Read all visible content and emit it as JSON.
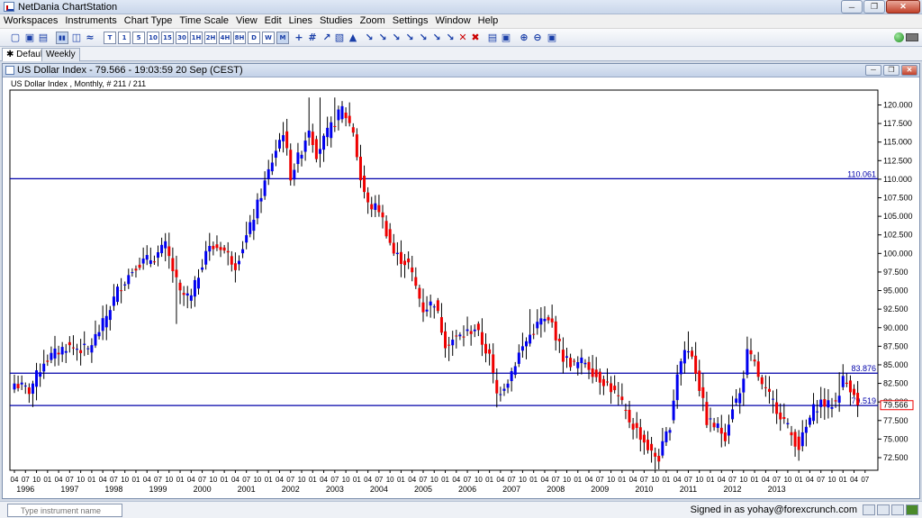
{
  "window": {
    "title": "NetDania ChartStation"
  },
  "menu": [
    "Workspaces",
    "Instruments",
    "Chart Type",
    "Time Scale",
    "View",
    "Edit",
    "Lines",
    "Studies",
    "Zoom",
    "Settings",
    "Window",
    "Help"
  ],
  "toolbar": {
    "interval_labels": [
      "T",
      "1",
      "5",
      "10",
      "15",
      "30",
      "1H",
      "2H",
      "4H",
      "8H",
      "D",
      "W",
      "M"
    ]
  },
  "tabs": [
    {
      "label": "Default"
    },
    {
      "label": "Weekly"
    }
  ],
  "chart_window": {
    "title": "US Dollar Index - 79.566 - 19:03:59  20 Sep (CEST)",
    "subtitle": "US Dollar Index , Monthly, # 211 / 211"
  },
  "search": {
    "placeholder": "Type instrument name"
  },
  "status": {
    "signed_in": "Signed in as yohay@forexcrunch.com"
  },
  "chart_data": {
    "type": "candlestick",
    "instrument": "US Dollar Index",
    "interval": "Monthly",
    "ylim": [
      70.8,
      122.0
    ],
    "y_ticks": [
      "72.500",
      "75.000",
      "77.500",
      "80.000",
      "82.500",
      "85.000",
      "87.500",
      "90.000",
      "92.500",
      "95.000",
      "97.500",
      "100.000",
      "102.500",
      "105.000",
      "107.500",
      "110.000",
      "112.500",
      "115.000",
      "117.500",
      "120.000"
    ],
    "year_labels": [
      "1996",
      "1997",
      "1998",
      "1999",
      "2000",
      "2001",
      "2002",
      "2003",
      "2004",
      "2005",
      "2006",
      "2007",
      "2008",
      "2009",
      "2010",
      "2011",
      "2012",
      "2013"
    ],
    "month_labels": [
      "04",
      "07",
      "10",
      "01"
    ],
    "horizontal_lines": [
      {
        "label": "110.061",
        "value": 110.061
      },
      {
        "label": "83.876",
        "value": 83.876
      },
      {
        "label": "79.519",
        "value": 79.519
      }
    ],
    "last_price": {
      "label": "79.566",
      "value": 79.566
    },
    "colors": {
      "up": "#0000ee",
      "down": "#ee0000",
      "line": "#0000aa"
    },
    "anchors": [
      [
        0,
        82.5
      ],
      [
        4,
        81.5
      ],
      [
        8,
        85.5
      ],
      [
        14,
        87.5
      ],
      [
        20,
        87.0
      ],
      [
        24,
        90.5
      ],
      [
        28,
        95.0
      ],
      [
        33,
        98.5
      ],
      [
        38,
        99.5
      ],
      [
        41,
        101.0
      ],
      [
        45,
        94.5
      ],
      [
        48,
        94.0
      ],
      [
        52,
        100.5
      ],
      [
        56,
        101.0
      ],
      [
        60,
        98.5
      ],
      [
        64,
        103.5
      ],
      [
        68,
        109.5
      ],
      [
        71,
        114.0
      ],
      [
        73,
        116.5
      ],
      [
        75,
        110.5
      ],
      [
        78,
        114.0
      ],
      [
        80,
        117.0
      ],
      [
        82,
        113.5
      ],
      [
        86,
        117.0
      ],
      [
        89,
        119.5
      ],
      [
        92,
        116.5
      ],
      [
        94,
        110.0
      ],
      [
        96,
        106.5
      ],
      [
        99,
        106.0
      ],
      [
        103,
        100.0
      ],
      [
        107,
        98.5
      ],
      [
        111,
        92.5
      ],
      [
        114,
        93.5
      ],
      [
        117,
        88.0
      ],
      [
        122,
        89.0
      ],
      [
        125,
        90.0
      ],
      [
        129,
        86.0
      ],
      [
        131,
        81.0
      ],
      [
        134,
        83.0
      ],
      [
        137,
        86.5
      ],
      [
        140,
        89.0
      ],
      [
        143,
        91.0
      ],
      [
        146,
        90.5
      ],
      [
        149,
        86.0
      ],
      [
        152,
        85.0
      ],
      [
        155,
        85.5
      ],
      [
        158,
        83.5
      ],
      [
        161,
        82.5
      ],
      [
        164,
        80.5
      ],
      [
        167,
        77.5
      ],
      [
        170,
        75.5
      ],
      [
        173,
        73.0
      ],
      [
        175,
        72.5
      ],
      [
        178,
        77.0
      ],
      [
        180,
        84.0
      ],
      [
        182,
        87.0
      ],
      [
        184,
        86.5
      ],
      [
        186,
        82.0
      ],
      [
        188,
        77.5
      ],
      [
        191,
        76.5
      ],
      [
        193,
        75.5
      ],
      [
        195,
        79.5
      ],
      [
        197,
        81.0
      ],
      [
        199,
        86.5
      ],
      [
        201,
        85.0
      ],
      [
        203,
        82.0
      ],
      [
        206,
        80.0
      ],
      [
        209,
        77.5
      ],
      [
        211,
        75.5
      ],
      [
        213,
        74.0
      ],
      [
        215,
        76.5
      ],
      [
        217,
        79.0
      ],
      [
        219,
        80.0
      ],
      [
        221,
        79.5
      ],
      [
        223,
        80.0
      ],
      [
        225,
        83.0
      ],
      [
        227,
        82.0
      ],
      [
        228,
        81.5
      ],
      [
        229,
        79.6
      ]
    ],
    "spikes": [
      [
        44,
        90.5,
        "low"
      ],
      [
        80,
        121.0,
        "high"
      ],
      [
        83,
        121.0,
        "high"
      ],
      [
        87,
        121.0,
        "high"
      ],
      [
        118,
        85.5,
        "low"
      ],
      [
        140,
        92.5,
        "high"
      ],
      [
        174,
        70.9,
        "low"
      ],
      [
        183,
        89.5,
        "high"
      ],
      [
        199,
        88.8,
        "high"
      ],
      [
        224,
        84.0,
        "high"
      ]
    ]
  }
}
